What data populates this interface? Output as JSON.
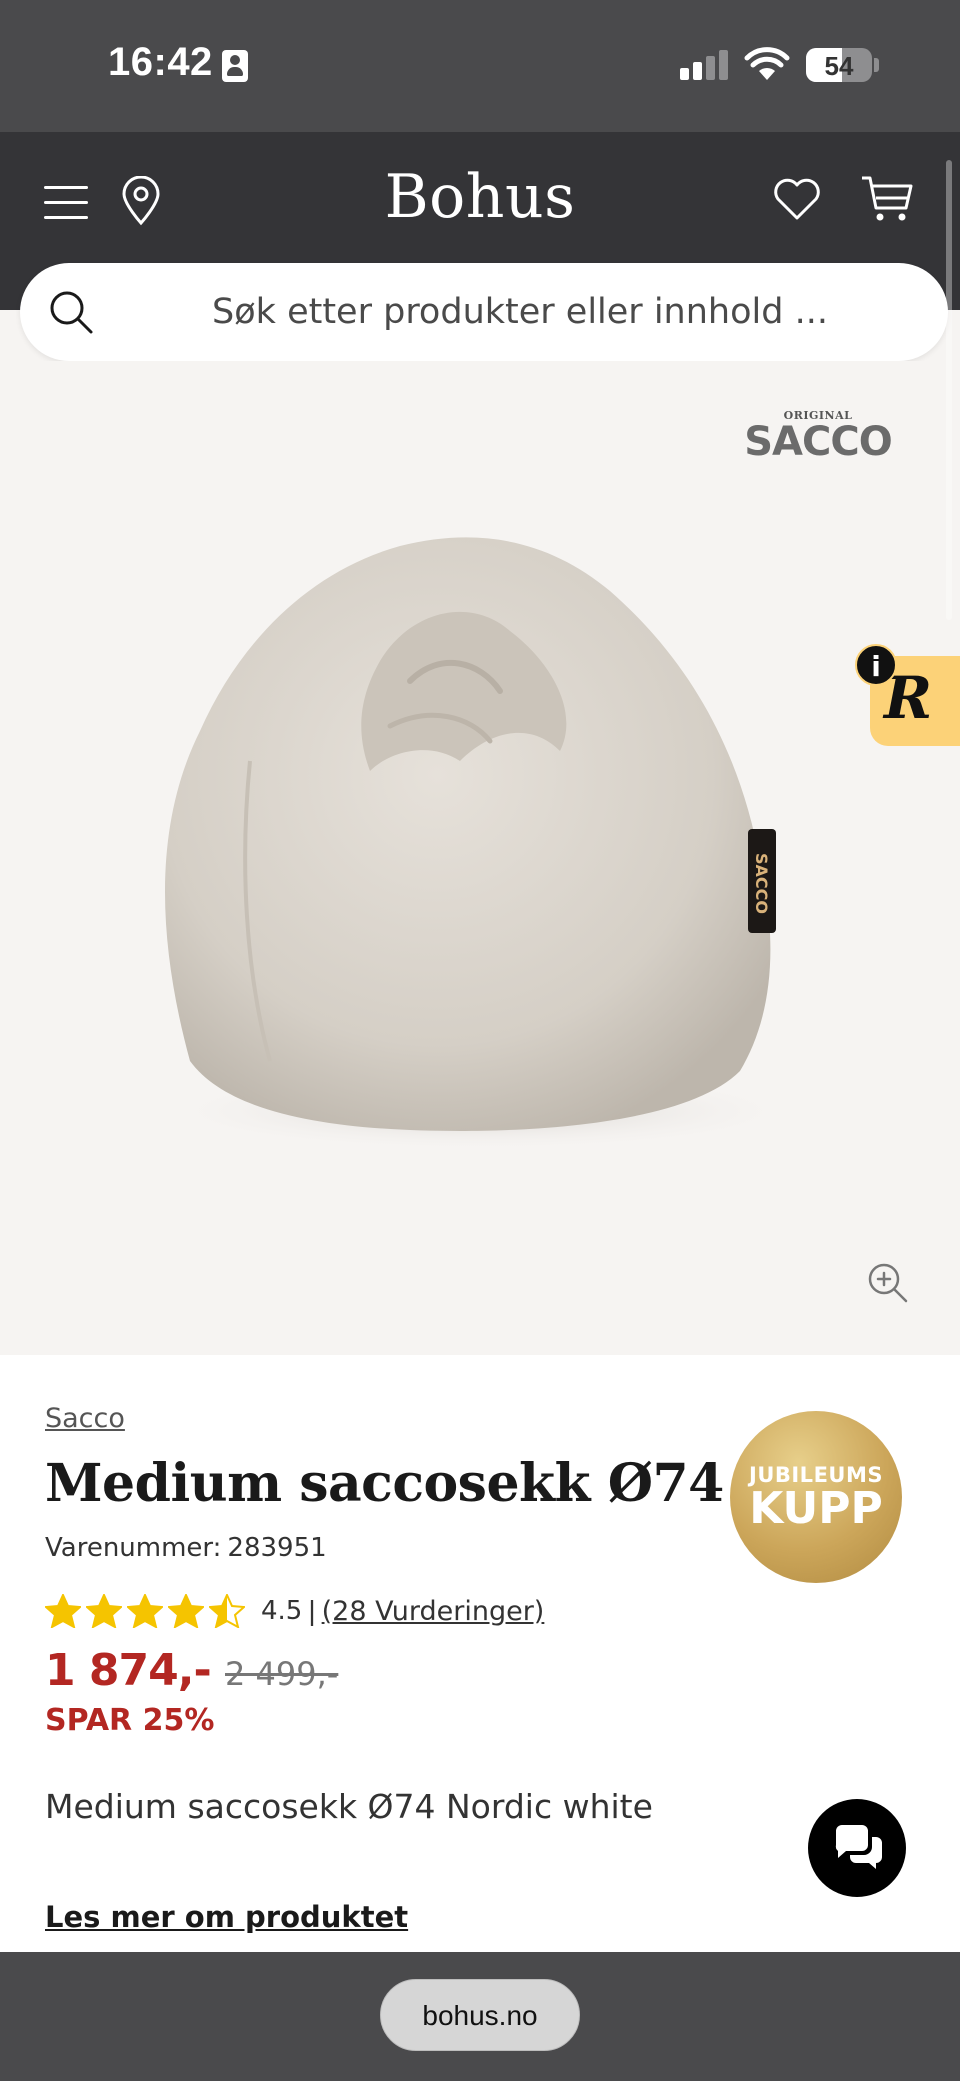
{
  "status_bar": {
    "time": "16:42",
    "battery": "54",
    "battery_level": 0.54,
    "icons": [
      "person-icon",
      "signal-icon",
      "wifi-icon",
      "battery-icon"
    ]
  },
  "header": {
    "logo": "Bohus",
    "icons": [
      "menu-icon",
      "location-pin-icon",
      "heart-icon",
      "cart-icon"
    ]
  },
  "search": {
    "placeholder": "Søk etter produkter eller innhold ..."
  },
  "gallery": {
    "brand_logo_small": "ORIGINAL",
    "brand_logo_name": "SACCO",
    "review_widget_letter": "R",
    "info_badge": "i"
  },
  "product": {
    "brand": "Sacco",
    "title": "Medium saccosekk Ø74",
    "sku_label": "Varenummer:",
    "sku_value": "283951",
    "badge_line1": "JUBILEUMS",
    "badge_line2": "KUPP",
    "rating_value": "4.5",
    "rating_separator": "|",
    "rating_stars": 4.5,
    "reviews_link": "(28 Vurderinger)",
    "price": "1 874,-",
    "old_price": "2 499,-",
    "save": "SPAR 25%",
    "description": "Medium saccosekk Ø74 Nordic white",
    "read_more": "Les mer om produktet"
  },
  "bottom_bar": {
    "url": "bohus.no"
  },
  "colors": {
    "header_bg": "#343437",
    "price_red": "#b32722",
    "star_yellow": "#f5c400",
    "badge_gold": "#cca65a",
    "review_widget_yellow": "#fcd278"
  }
}
